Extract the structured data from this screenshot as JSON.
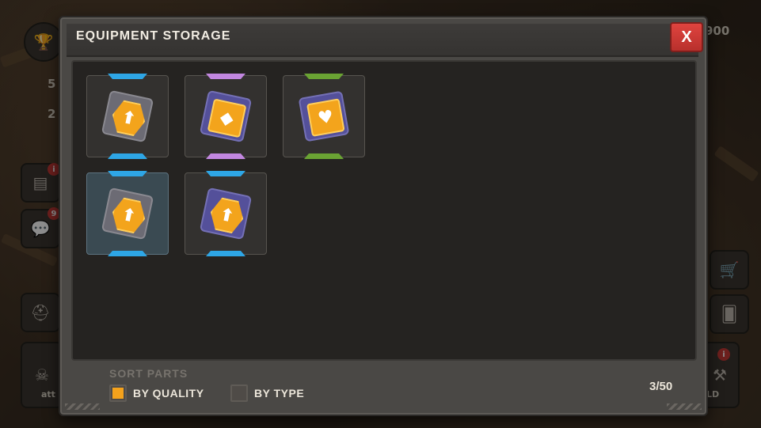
{
  "hud": {
    "top_right_value": "900",
    "left_count_1": "5",
    "left_count_2": "2",
    "bottom_left_label": "att",
    "bottom_right_label": "LD",
    "notification_badge": "i",
    "chat_badge": "9"
  },
  "dialog": {
    "title": "EQUIPMENT STORAGE",
    "close_label": "X",
    "sort_label": "SORT PARTS",
    "sort_options": [
      {
        "label": "BY QUALITY",
        "checked": true
      },
      {
        "label": "BY TYPE",
        "checked": false
      }
    ],
    "capacity": "3/50"
  },
  "items": [
    {
      "rarity": "blue",
      "icon": "rocket-chip-icon",
      "selected": false
    },
    {
      "rarity": "purple",
      "icon": "shield-chip-icon",
      "selected": false
    },
    {
      "rarity": "green",
      "icon": "heart-chip-icon",
      "selected": false
    },
    {
      "rarity": "blue",
      "icon": "rocket-chip-icon",
      "selected": true
    },
    {
      "rarity": "blue",
      "icon": "rocket-chip-icon",
      "selected": false
    }
  ],
  "colors": {
    "rarity_blue": "#2ea6e6",
    "rarity_purple": "#c287e0",
    "rarity_green": "#6aa333",
    "accent_orange": "#f4a21c",
    "close_red": "#d63b36"
  }
}
